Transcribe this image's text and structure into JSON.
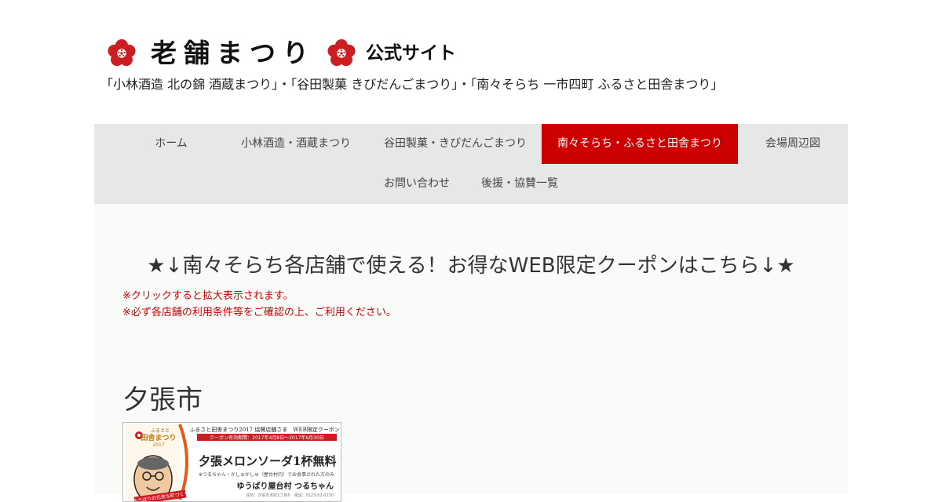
{
  "header": {
    "logo_text": "老舗まつり",
    "logo_sub": "公式サイト",
    "tagline": "「小林酒造 北の錦 酒蔵まつり」・「谷田製菓 きびだんごまつり」・「南々そらち 一市四町 ふるさと田舎まつり」"
  },
  "nav": {
    "items": [
      {
        "label": "ホーム"
      },
      {
        "label": "小林酒造・酒蔵まつり"
      },
      {
        "label": "谷田製菓・きびだんごまつり"
      },
      {
        "label": "南々そらち・ふるさと田舎まつり",
        "active": true
      },
      {
        "label": "会場周辺図"
      },
      {
        "label": "お問い合わせ"
      },
      {
        "label": "後援・協賛一覧"
      }
    ],
    "active_color": "#cc0000"
  },
  "main": {
    "banner": "★↓南々そらち各店舗で使える！お得なWEB限定クーポンはこちら↓★",
    "notes": [
      "※クリックすると拡大表示されます。",
      "※必ず各店舗の利用条件等をご確認の上、ご利用ください。"
    ],
    "section_title": "夕張市"
  },
  "coupon": {
    "header_line": "ふるさと田舎まつり2017 協賛店舗さま　WEB限定クーポン",
    "validity": "クーポン有効期間：2017年4月8日〜2017年6月30日",
    "badge_small": "ふるさと",
    "badge_main": "田舎まつり",
    "badge_year": "2017",
    "offer": "夕張メロンソーダ1杯無料",
    "condition": "※つるちゃん・かしゅかしゅ（屋台村内）でお食事された方のみ",
    "shop": "ゆうばり屋台村 つるちゃん",
    "address": "住所：夕張市本町1丁目6　電話：0123-52-0230",
    "ribbon": "ゆうばりの元気な町づくり"
  },
  "colors": {
    "accent": "#cc0000",
    "nav_bg": "#e6e7e7",
    "content_bg": "#f9fbf9"
  }
}
